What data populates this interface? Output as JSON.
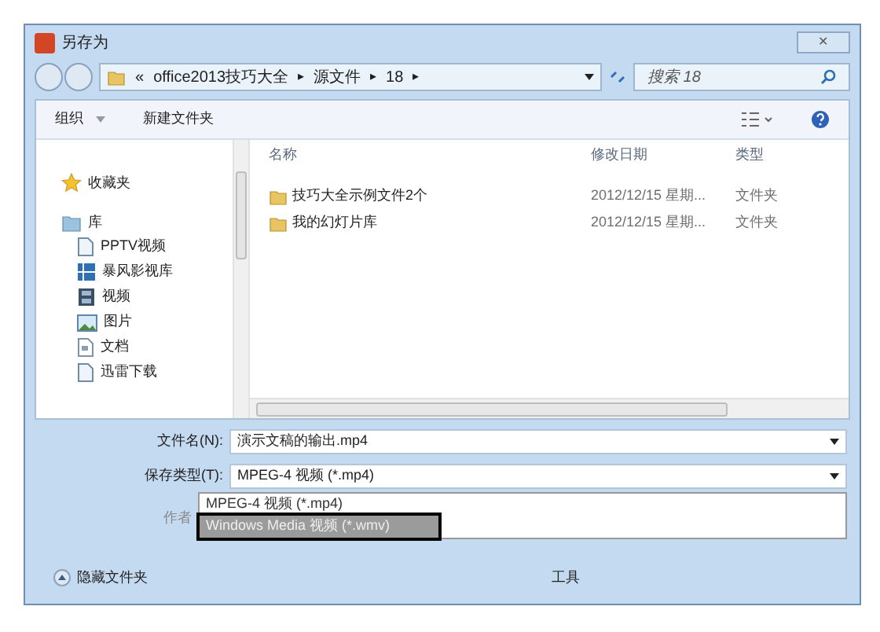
{
  "window": {
    "title": "另存为",
    "close": "✕"
  },
  "address": {
    "prefix": "«",
    "crumbs": [
      "office2013技巧大全",
      "源文件",
      "18"
    ],
    "separator": "▸"
  },
  "search": {
    "placeholder": "搜索 18"
  },
  "toolbar": {
    "organize": "组织",
    "new_folder": "新建文件夹"
  },
  "sidebar": {
    "items": [
      {
        "label": "收藏夹",
        "kind": "favorites"
      },
      {
        "label": "库",
        "kind": "library",
        "children": [
          {
            "label": "PPTV视频",
            "kind": "file"
          },
          {
            "label": "暴风影视库",
            "kind": "media"
          },
          {
            "label": "视频",
            "kind": "video"
          },
          {
            "label": "图片",
            "kind": "picture"
          },
          {
            "label": "文档",
            "kind": "doc"
          },
          {
            "label": "迅雷下载",
            "kind": "file"
          }
        ]
      }
    ]
  },
  "table": {
    "columns": [
      "名称",
      "修改日期",
      "类型"
    ],
    "rows": [
      {
        "name": "技巧大全示例文件2个",
        "modified": "2012/12/15 星期...",
        "type": "文件夹"
      },
      {
        "name": "我的幻灯片库",
        "modified": "2012/12/15 星期...",
        "type": "文件夹"
      }
    ]
  },
  "form": {
    "file_name_label": "文件名(N):",
    "file_name": "演示文稿的输出.mp4",
    "type_label": "保存类型(T):",
    "type_value": "MPEG-4 视频 (*.mp4)",
    "author_label": "作者",
    "options": [
      {
        "label": "MPEG-4 视频 (*.mp4)",
        "selected": false
      },
      {
        "label": "Windows Media 视频 (*.wmv)",
        "selected": true
      }
    ]
  },
  "footer": {
    "hide_folders": "隐藏文件夹",
    "tools": "工具"
  }
}
